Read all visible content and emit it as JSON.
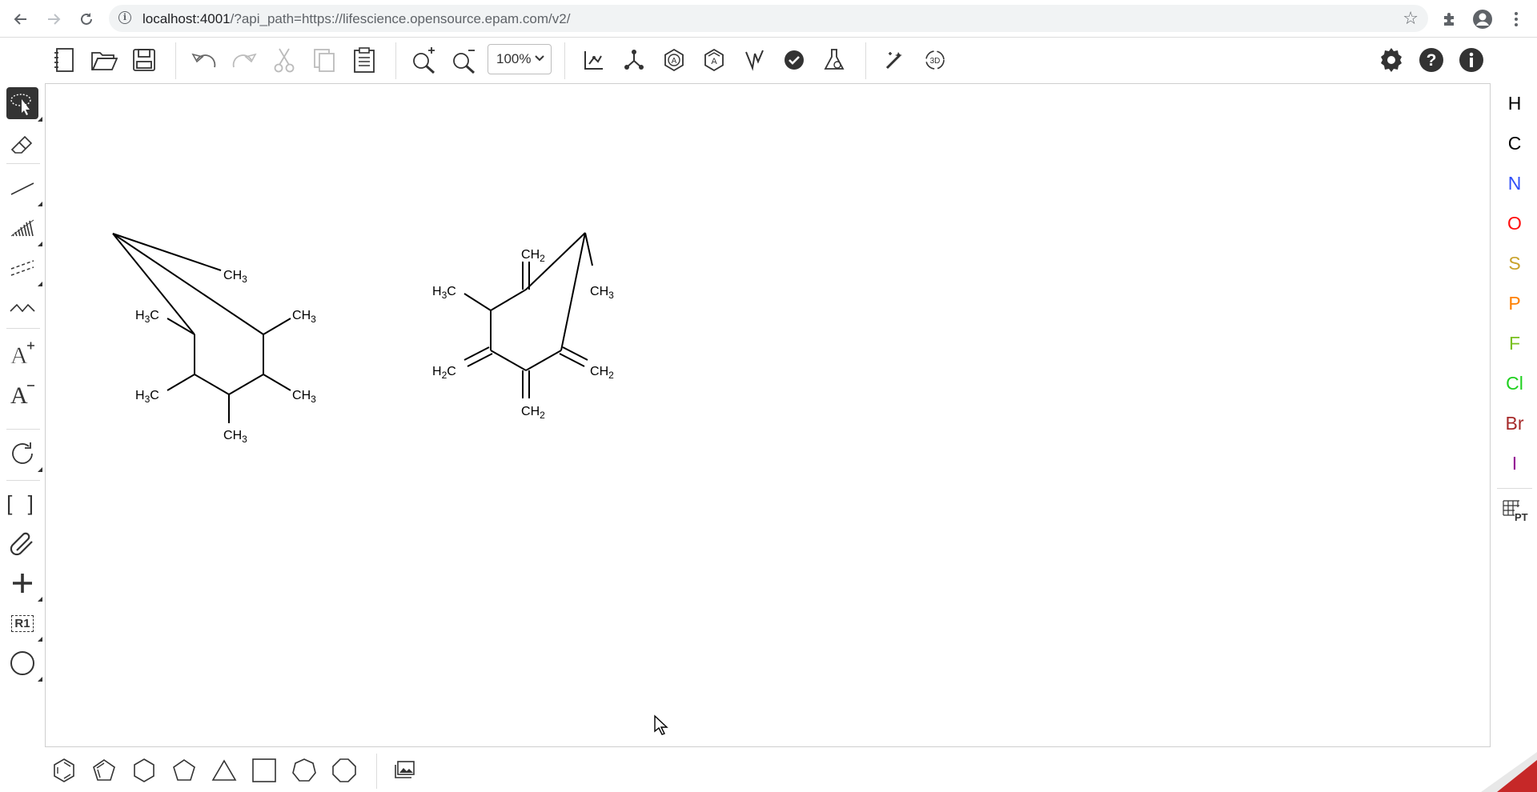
{
  "browser": {
    "url_host": "localhost:4001",
    "url_path": "/?api_path=https://lifescience.opensource.epam.com/v2/",
    "icons": [
      "back-arrow-icon",
      "forward-arrow-icon",
      "reload-icon",
      "info-icon",
      "bookmark-star-icon",
      "extensions-puzzle-icon",
      "profile-avatar-icon",
      "kebab-menu-icon"
    ]
  },
  "toolbar": {
    "zoom_value": "100%",
    "buttons": [
      "new-document",
      "open-file",
      "save-file",
      "undo",
      "redo",
      "cut",
      "copy",
      "paste",
      "zoom-in",
      "zoom-out",
      "layout",
      "clean-up",
      "aromatize",
      "dearomatize",
      "calculate-cip",
      "check-structure",
      "analyse",
      "recognize-image",
      "3d-viewer",
      "settings",
      "help",
      "about"
    ]
  },
  "left_tools": {
    "bracket_label": "[ ]",
    "rgroup_label": "R1",
    "text_increase_label": "A+",
    "text_decrease_label": "A-"
  },
  "atoms": [
    {
      "symbol": "H",
      "color": "#000000"
    },
    {
      "symbol": "C",
      "color": "#000000"
    },
    {
      "symbol": "N",
      "color": "#3050F8"
    },
    {
      "symbol": "O",
      "color": "#FF0D0D"
    },
    {
      "symbol": "S",
      "color": "#C9A22B"
    },
    {
      "symbol": "P",
      "color": "#FF8000"
    },
    {
      "symbol": "F",
      "color": "#78C01E"
    },
    {
      "symbol": "Cl",
      "color": "#1FD01F"
    },
    {
      "symbol": "Br",
      "color": "#A62929"
    },
    {
      "symbol": "I",
      "color": "#940094"
    }
  ],
  "periodic_table_label": "PT",
  "molecule1": {
    "labels": {
      "ch3_top": "CH3",
      "h3c_left": "H3C",
      "ch3_right_top": "CH3",
      "h3c_bottom_left": "H3C",
      "ch3_right_bottom": "CH3",
      "ch3_bottom": "CH3"
    }
  },
  "molecule2": {
    "labels": {
      "ch2_top": "CH2",
      "h3c_left": "H3C",
      "ch3_right": "CH3",
      "h2c_left": "H2C",
      "ch2_right": "CH2",
      "ch2_bottom": "CH2"
    }
  }
}
